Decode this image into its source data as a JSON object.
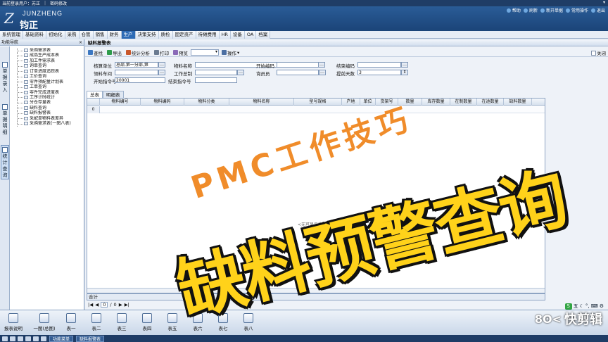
{
  "titlebar": {
    "user": "当前登录用户：苏正",
    "doc": "密码修改"
  },
  "logo": {
    "en": "JUNZHENG",
    "cn": "钧正"
  },
  "header_tools": [
    "帮助",
    "刷新",
    "新开单据",
    "常用操作",
    "退出"
  ],
  "menu": {
    "items": [
      "系统管理",
      "基础资料",
      "初始化",
      "采购",
      "仓管",
      "销售",
      "财务",
      "生产",
      "决策支持",
      "质检",
      "固定资产",
      "待摊费用",
      "HR",
      "设备",
      "OA",
      "档案"
    ],
    "active_index": 7
  },
  "leftpanel": {
    "title": "功能导航",
    "vtabs": [
      "单据录入",
      "单据明细",
      "统计查询"
    ],
    "tree": [
      "采购需求表",
      "成品生产成本表",
      "加工件需求表",
      "询单查询",
      "订单进度追踪表",
      "工价查询",
      "零件预配量计划表",
      "工单查询",
      "零件完成进度表",
      "工序计时统计",
      "分仓存量表",
      "缺料查询",
      "缺料报警表",
      "采配单物料表差异",
      "采购需求表(一图八表)"
    ]
  },
  "doc": {
    "title": "缺料报警表"
  },
  "toolbar": {
    "buttons": [
      "查找",
      "导出",
      "统计分析",
      "打印",
      "预览"
    ],
    "ops": "操作",
    "close": "关闭"
  },
  "filters": {
    "dept_label": "核算单位",
    "dept_value": "总部,第一分部,第",
    "material_name_label": "物料名称",
    "start_code_label": "开始编码",
    "end_code_label": "结束编码",
    "material_cat_label": "领料车间",
    "workorder_label": "工作总制",
    "buyer_label": "询员员",
    "advance_label": "提前天数",
    "advance_value": "3",
    "start_order_label": "开始指令号",
    "start_order_value": "20001",
    "end_order_label": "结束指令号"
  },
  "grid": {
    "tabs": [
      "总表",
      "明细表"
    ],
    "columns": [
      "物料编号",
      "物料编码",
      "物料分类",
      "物料名称",
      "型号规格",
      "产地",
      "单位",
      "货架号",
      "数量",
      "库存数量",
      "在制数量",
      "在途数量",
      "缺料数量"
    ],
    "row_number": "0",
    "empty_text": "<无可显示的数据>"
  },
  "totals": {
    "label": "合计"
  },
  "pager": {
    "current": "0",
    "total": "0"
  },
  "shortcuts": [
    "报表说明",
    "一图(总图)",
    "表一",
    "表二",
    "表三",
    "表四",
    "表五",
    "表六",
    "表七",
    "表八"
  ],
  "taskbar": {
    "buttons": [
      "功能菜单",
      "缺料报警表"
    ]
  },
  "overlay": {
    "subtitle": "PMC工作技巧",
    "headline": "缺料预警查询"
  },
  "watermark": {
    "text": "快剪辑"
  },
  "ime": {
    "label": "五"
  }
}
